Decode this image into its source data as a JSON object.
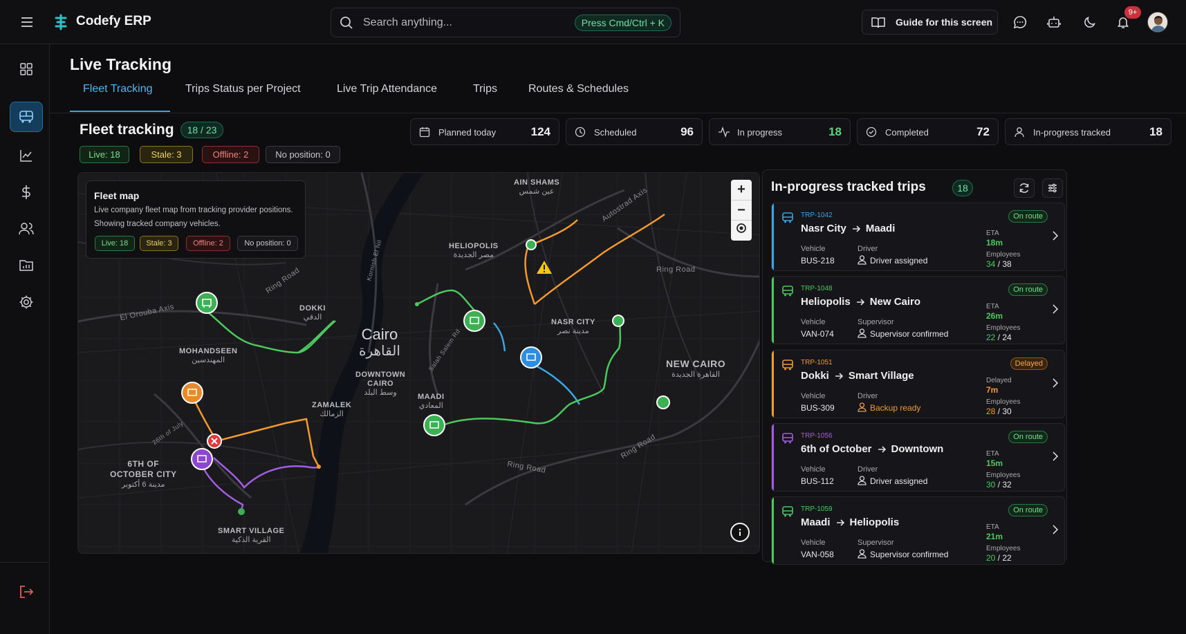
{
  "header": {
    "brand": "Codefy ERP",
    "search_placeholder": "Search anything...",
    "search_shortcut": "Press Cmd/Ctrl + K",
    "guide_label": "Guide for this screen",
    "notification_count": "9+",
    "icons": [
      "menu-icon",
      "logo-icon",
      "search-icon",
      "book-icon",
      "chat-icon",
      "robot-icon",
      "moon-icon",
      "bell-icon"
    ]
  },
  "sidebar": {
    "items": [
      "dashboard-icon",
      "bus-icon",
      "chart-icon",
      "dollar-icon",
      "users-icon",
      "report-icon",
      "settings-icon"
    ],
    "active": "bus-icon",
    "logout": "logout-icon"
  },
  "page": {
    "title": "Live Tracking",
    "tabs": [
      {
        "label": "Fleet Tracking",
        "active": true
      },
      {
        "label": "Trips Status per Project"
      },
      {
        "label": "Live Trip Attendance"
      },
      {
        "label": "Trips"
      },
      {
        "label": "Routes & Schedules"
      }
    ]
  },
  "fleet": {
    "title": "Fleet tracking",
    "count": "18 / 23",
    "chips": {
      "live": "Live: 18",
      "stale": "Stale: 3",
      "offline": "Offline: 2",
      "no_position": "No position: 0"
    }
  },
  "stats": [
    {
      "label": "Planned today",
      "value": "124",
      "icon": "calendar-icon"
    },
    {
      "label": "Scheduled",
      "value": "96",
      "icon": "clock-icon"
    },
    {
      "label": "In progress",
      "value": "18",
      "icon": "activity-icon"
    },
    {
      "label": "Completed",
      "value": "72",
      "icon": "check-circle-icon"
    },
    {
      "label": "In-progress tracked",
      "value": "18",
      "icon": "user-pin-icon"
    }
  ],
  "map": {
    "card_title": "Fleet map",
    "card_desc1": "Live company fleet map from tracking provider positions.",
    "card_desc2": "Showing tracked company vehicles.",
    "chips": {
      "live": "Live: 18",
      "stale": "Stale: 3",
      "offline": "Offline: 2",
      "no_position": "No position: 0"
    },
    "zoom_in": "+",
    "zoom_out": "−",
    "labels": {
      "ain_shams": "AIN SHAMS",
      "ain_shams_ar": "عين شمس",
      "heliopolis": "HELIOPOLIS",
      "heliopolis_ar": "مصر الجديدة",
      "dokki": "DOKKI",
      "dokki_ar": "الدقي",
      "cairo": "Cairo",
      "cairo_ar": "القاهرة",
      "nasr_city": "NASR CITY",
      "nasr_city_ar": "مدينة نصر",
      "mohandseen": "MOHANDSEEN",
      "mohandseen_ar": "المهندسين",
      "downtown": "DOWNTOWN",
      "downtown2": "CAIRO",
      "downtown_ar": "وسط البلد",
      "new_cairo": "NEW CAIRO",
      "new_cairo_ar": "القاهرة الجديدة",
      "maadi": "MAADI",
      "maadi_ar": "المعادي",
      "zamalek": "ZAMALEK",
      "zamalek_ar": "الزمالك",
      "october": "6TH OF",
      "october2": "OCTOBER CITY",
      "october_ar": "مدينة 6 أكتوبر",
      "smart_village": "SMART VILLAGE",
      "smart_village_ar": "القرية الذكية",
      "road_el_orouba": "El Orouba Axis",
      "road_autostrad": "Autostrad Axis",
      "road_ring1": "Ring Road",
      "road_ring2": "Ring Road",
      "road_ring3": "Ring Road",
      "road_ring4": "Ring Road",
      "road_kornish": "Kornish El Nil",
      "road_salah": "Salah Salem Rd",
      "road_26july": "26th of July"
    }
  },
  "trips_panel": {
    "title": "In-progress tracked trips",
    "count": "18",
    "trips": [
      {
        "id": "TRP-1042",
        "from": "Nasr City",
        "to": "Maadi",
        "status": "On route",
        "vehicle_label": "Vehicle",
        "vehicle": "BUS-218",
        "person_label": "Driver",
        "person": "Driver assigned",
        "eta_label": "ETA",
        "eta": "18m",
        "emp_label": "Employees",
        "emp_now": "34",
        "emp_total": " / 38",
        "color": "#3aa6e6"
      },
      {
        "id": "TRP-1048",
        "from": "Heliopolis",
        "to": "New Cairo",
        "status": "On route",
        "vehicle_label": "Vehicle",
        "vehicle": "VAN-074",
        "person_label": "Supervisor",
        "person": "Supervisor confirmed",
        "eta_label": "ETA",
        "eta": "26m",
        "emp_label": "Employees",
        "emp_now": "22",
        "emp_total": " / 24",
        "color": "#4cc95e"
      },
      {
        "id": "TRP-1051",
        "from": "Dokki",
        "to": "Smart Village",
        "status": "Delayed",
        "vehicle_label": "Vehicle",
        "vehicle": "BUS-309",
        "person_label": "Driver",
        "person": "Backup ready",
        "eta_label": "Delayed",
        "eta": "7m",
        "emp_label": "Employees",
        "emp_now": "28",
        "emp_total": " / 30",
        "color": "#f29a2e"
      },
      {
        "id": "TRP-1056",
        "from": "6th of October",
        "to": "Downtown",
        "status": "On route",
        "vehicle_label": "Vehicle",
        "vehicle": "BUS-112",
        "person_label": "Driver",
        "person": "Driver assigned",
        "eta_label": "ETA",
        "eta": "15m",
        "emp_label": "Employees",
        "emp_now": "30",
        "emp_total": " / 32",
        "color": "#a45ee6"
      },
      {
        "id": "TRP-1059",
        "from": "Maadi",
        "to": "Heliopolis",
        "status": "On route",
        "vehicle_label": "Vehicle",
        "vehicle": "VAN-058",
        "person_label": "Supervisor",
        "person": "Supervisor confirmed",
        "eta_label": "ETA",
        "eta": "21m",
        "emp_label": "Employees",
        "emp_now": "20",
        "emp_total": " / 22",
        "color": "#4cc95e"
      }
    ]
  }
}
